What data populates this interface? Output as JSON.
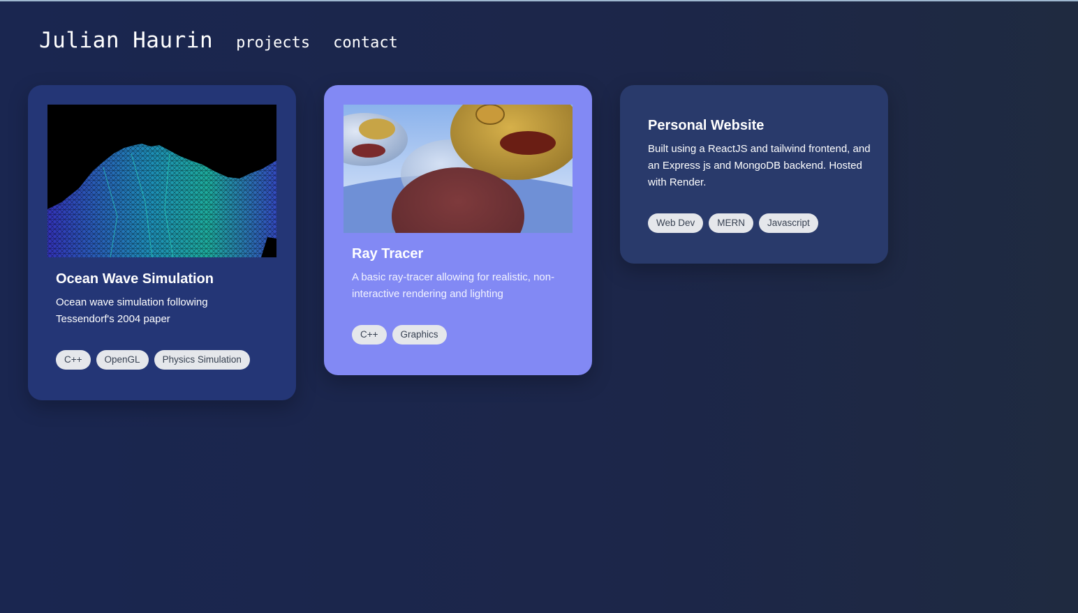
{
  "nav": {
    "brand": "Julian Haurin",
    "links": [
      "projects",
      "contact"
    ]
  },
  "projects": [
    {
      "title": "Ocean Wave Simulation",
      "description": "Ocean wave simulation following Tessendorf's 2004 paper",
      "tags": [
        "C++",
        "OpenGL",
        "Physics Simulation"
      ],
      "image": "ocean-wireframe-image",
      "card_color": "#243676"
    },
    {
      "title": "Ray Tracer",
      "description": "A basic ray-tracer allowing for realistic, non-interactive rendering and lighting",
      "tags": [
        "C++",
        "Graphics"
      ],
      "image": "ray-traced-spheres-image",
      "card_color": "#8289f4"
    },
    {
      "title": "Personal Website",
      "description": "Built using a ReactJS and tailwind frontend, and an Express js and MongoDB backend. Hosted with Render.",
      "tags": [
        "Web Dev",
        "MERN",
        "Javascript"
      ],
      "card_color": "#293a6b"
    }
  ],
  "colors": {
    "background": "#1c2649",
    "tag_background": "#e5e7eb",
    "tag_text": "#374151"
  }
}
